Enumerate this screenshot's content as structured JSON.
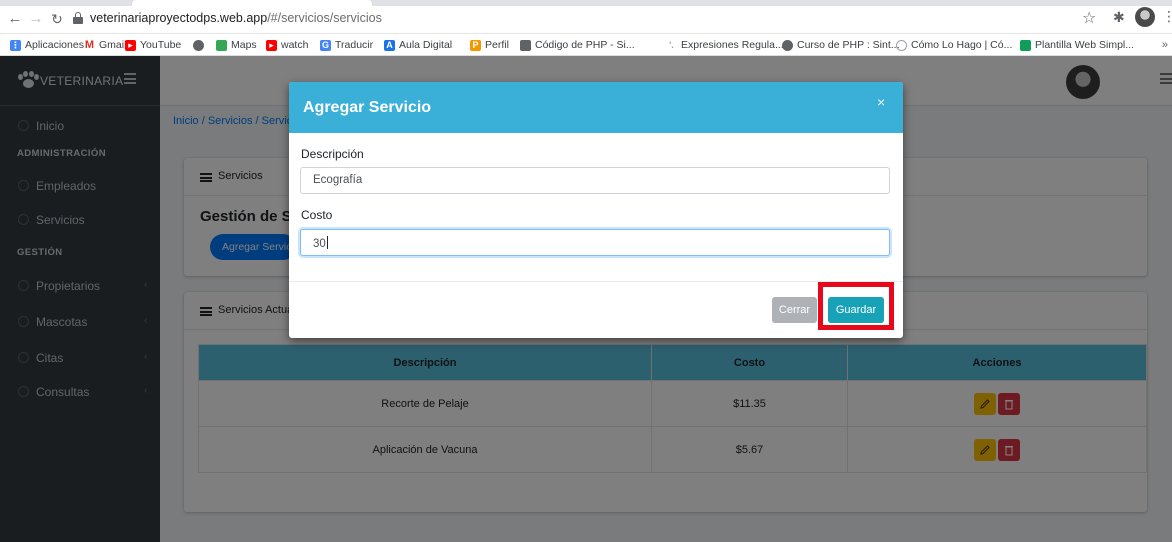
{
  "browser": {
    "url_host": "veterinariaproyectodps.web.app",
    "url_path": "/#/servicios/servicios",
    "bookmarks": [
      {
        "label": "Aplicaciones",
        "icon": "apps-grid-icon",
        "color": "#4285f4"
      },
      {
        "label": "Gmail",
        "icon": "gmail-icon",
        "color": "#d93025"
      },
      {
        "label": "YouTube",
        "icon": "youtube-icon",
        "color": "#ff0000"
      },
      {
        "label": "",
        "icon": "globe-icon",
        "color": "#5f6368"
      },
      {
        "label": "Maps",
        "icon": "maps-icon",
        "color": "#34a853"
      },
      {
        "label": "watch",
        "icon": "youtube-icon",
        "color": "#ff0000"
      },
      {
        "label": "Traducir",
        "icon": "translate-icon",
        "color": "#4285f4"
      },
      {
        "label": "Aula Digital",
        "icon": "aula-icon",
        "color": "#1a73e8"
      },
      {
        "label": "Perfil",
        "icon": "perfil-icon",
        "color": "#f29900"
      },
      {
        "label": "Código de PHP - Si...",
        "icon": "php-icon",
        "color": "#5f6368"
      },
      {
        "label": "Expresiones Regula...",
        "icon": "regex-icon",
        "color": "#9aa0a6"
      },
      {
        "label": "Curso de PHP : Sint...",
        "icon": "globe-icon",
        "color": "#5f6368"
      },
      {
        "label": "Cómo Lo Hago | Có...",
        "icon": "site-icon",
        "color": "#9aa0a6"
      },
      {
        "label": "Plantilla Web Simpl...",
        "icon": "template-icon",
        "color": "#0f9d58"
      }
    ],
    "more": "»"
  },
  "app": {
    "brand": "VETERINARIA",
    "breadcrumb": "Inicio / Servicios / Servicios",
    "sidebar": {
      "inicio": "Inicio",
      "section_admin": "ADMINISTRACIÓN",
      "empleados": "Empleados",
      "servicios": "Servicios",
      "section_gestion": "GESTIÓN",
      "propietarios": "Propietarios",
      "mascotas": "Mascotas",
      "citas": "Citas",
      "consultas": "Consultas"
    },
    "card1": {
      "header": "Servicios",
      "title": "Gestión de Servicios",
      "add_button": "Agregar Servicio"
    },
    "card2": {
      "header": "Servicios Actuales"
    },
    "table": {
      "columns": [
        "Descripción",
        "Costo",
        "Acciones"
      ],
      "rows": [
        {
          "descripcion": "Recorte de Pelaje",
          "costo": "$11.35"
        },
        {
          "descripcion": "Aplicación de Vacuna",
          "costo": "$5.67"
        }
      ]
    }
  },
  "modal": {
    "title": "Agregar Servicio",
    "close": "×",
    "descripcion_label": "Descripción",
    "descripcion_value": "Ecografía",
    "costo_label": "Costo",
    "costo_value": "30",
    "cerrar": "Cerrar",
    "guardar": "Guardar"
  },
  "colors": {
    "sidebar": "#343a40",
    "modal_header": "#3aafd8",
    "primary": "#007bff",
    "info": "#17a2b8",
    "table_header": "#5bc0de",
    "highlight": "#e8081c"
  }
}
